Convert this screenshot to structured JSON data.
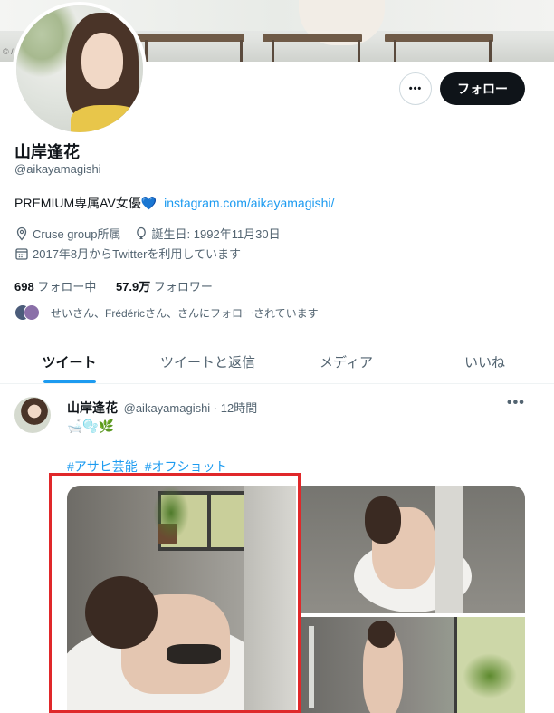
{
  "banner": {
    "copyright": "© /"
  },
  "profile": {
    "name": "山岸逢花",
    "handle": "@aikayamagishi",
    "bio_text": "PREMIUM専属AV女優",
    "bio_heart": "💙",
    "bio_link": "instagram.com/aikayamagishi/",
    "location": "Cruse group所属",
    "birthday": "誕生日: 1992年11月30日",
    "joined": "2017年8月からTwitterを利用しています",
    "following_count": "698",
    "following_label": "フォロー中",
    "followers_count": "57.9万",
    "followers_label": "フォロワー",
    "followed_by": "せいさん、Frédéricさん、さんにフォローされています"
  },
  "actions": {
    "more_label": "•••",
    "follow_label": "フォロー"
  },
  "tabs": [
    {
      "label": "ツイート",
      "active": true
    },
    {
      "label": "ツイートと返信",
      "active": false
    },
    {
      "label": "メディア",
      "active": false
    },
    {
      "label": "いいね",
      "active": false
    }
  ],
  "tweet": {
    "author_name": "山岸逢花",
    "author_handle": "@aikayamagishi",
    "time": "· 12時間",
    "more": "•••",
    "emojis": "🛁🫧🌿",
    "hashtags": [
      "#アサヒ芸能",
      "#オフショット"
    ]
  },
  "colors": {
    "accent": "#1d9bf0",
    "highlight": "#e0282a",
    "follow_bg": "#0f1419"
  }
}
